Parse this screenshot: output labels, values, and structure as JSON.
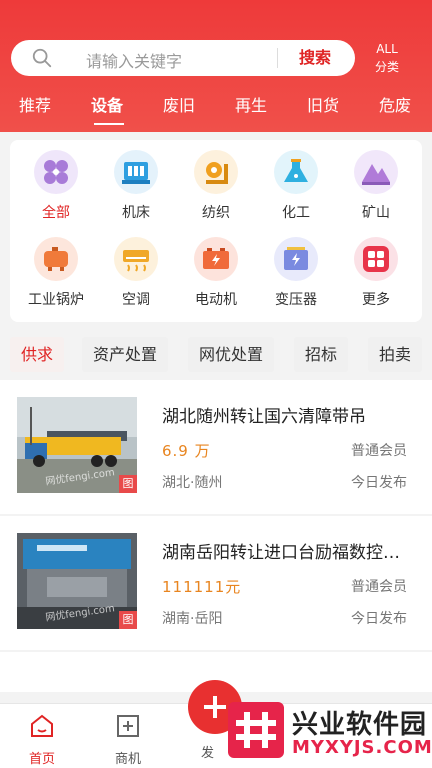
{
  "search": {
    "placeholder": "请输入关键字",
    "button_label": "搜索"
  },
  "all_categories": {
    "line1": "ALL",
    "line2": "分类"
  },
  "tabs": [
    {
      "label": "推荐"
    },
    {
      "label": "设备"
    },
    {
      "label": "废旧"
    },
    {
      "label": "再生"
    },
    {
      "label": "旧货"
    },
    {
      "label": "危废"
    }
  ],
  "active_tab": "设备",
  "categories": [
    {
      "label": "全部",
      "icon": "all-icon",
      "color": "#a87bd8"
    },
    {
      "label": "机床",
      "icon": "machine-tool-icon",
      "color": "#2f9fe0"
    },
    {
      "label": "纺织",
      "icon": "textile-icon",
      "color": "#f0a020"
    },
    {
      "label": "化工",
      "icon": "flask-icon",
      "color": "#2fb0e0"
    },
    {
      "label": "矿山",
      "icon": "mountain-icon",
      "color": "#b07bd8"
    },
    {
      "label": "工业锅炉",
      "icon": "boiler-icon",
      "color": "#f07a3a"
    },
    {
      "label": "空调",
      "icon": "air-conditioner-icon",
      "color": "#f0a828"
    },
    {
      "label": "电动机",
      "icon": "battery-icon",
      "color": "#f06a3a"
    },
    {
      "label": "变压器",
      "icon": "transformer-icon",
      "color": "#7a8ae0"
    },
    {
      "label": "更多",
      "icon": "more-icon",
      "color": "#e8344a"
    }
  ],
  "filters": [
    {
      "label": "供求"
    },
    {
      "label": "资产处置"
    },
    {
      "label": "网优处置"
    },
    {
      "label": "招标"
    },
    {
      "label": "拍卖"
    }
  ],
  "listings": [
    {
      "title": "湖北随州转让国六清障带吊",
      "price": "6.9 万",
      "member": "普通会员",
      "location": "湖北·随州",
      "time": "今日发布",
      "badge": "图",
      "watermark": "网优fengi.com"
    },
    {
      "title": "湖南岳阳转让进口台励福数控冲床",
      "price": "111111元",
      "member": "普通会员",
      "location": "湖南·岳阳",
      "time": "今日发布",
      "badge": "图",
      "watermark": "网优fengi.com"
    }
  ],
  "bottom_nav": {
    "home": "首页",
    "business": "商机",
    "publish": "发"
  },
  "site_watermark": {
    "title": "兴业软件园",
    "url": "MYXYJS.COM"
  },
  "colors": {
    "brand_red": "#e02424",
    "price_orange": "#e88520"
  }
}
